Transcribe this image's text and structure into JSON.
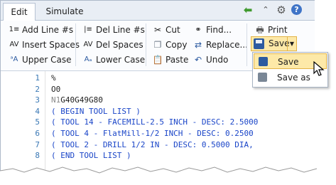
{
  "tabs": [
    {
      "label": "Edit",
      "active": true
    },
    {
      "label": "Simulate",
      "active": false
    }
  ],
  "ribbon": {
    "group1": {
      "add_line_nums": "Add Line #s",
      "insert_spaces": "Insert Spaces",
      "upper_case": "Upper Case"
    },
    "group2": {
      "del_line_nums": "Del Line #s",
      "del_spaces": "Del Spaces",
      "lower_case": "Lower Case"
    },
    "group3": {
      "cut": "Cut",
      "copy": "Copy",
      "paste": "Paste"
    },
    "group4": {
      "find": "Find...",
      "replace": "Replace...",
      "undo": "Undo"
    },
    "group5": {
      "print": "Print",
      "save": "Save"
    }
  },
  "save_menu": {
    "items": [
      {
        "label": "Save",
        "highlighted": true
      },
      {
        "label": "Save as",
        "highlighted": false
      }
    ]
  },
  "editor": {
    "lines": [
      {
        "num": "1",
        "text": "%"
      },
      {
        "num": "2",
        "text": "O0"
      },
      {
        "num": "3",
        "prefix": "N1",
        "text": "G40G49G80"
      },
      {
        "num": "4",
        "text": "( BEGIN TOOL LIST )"
      },
      {
        "num": "5",
        "text": "( TOOL 14 - FACEMILL-2.5 INCH - DESC: 2.5000"
      },
      {
        "num": "6",
        "text": "( TOOL 4 - FlatMill-1/2 INCH - DESC: 0.2500"
      },
      {
        "num": "7",
        "text": "( TOOL 2 - DRILL 1/2 IN - DESC: 0.5000 DIA,"
      },
      {
        "num": "8",
        "text": "( END TOOL LIST )"
      }
    ]
  },
  "colors": {
    "line_number": "#3a78b5",
    "comment": "#1a45c8",
    "highlight": "#fde9a8"
  }
}
